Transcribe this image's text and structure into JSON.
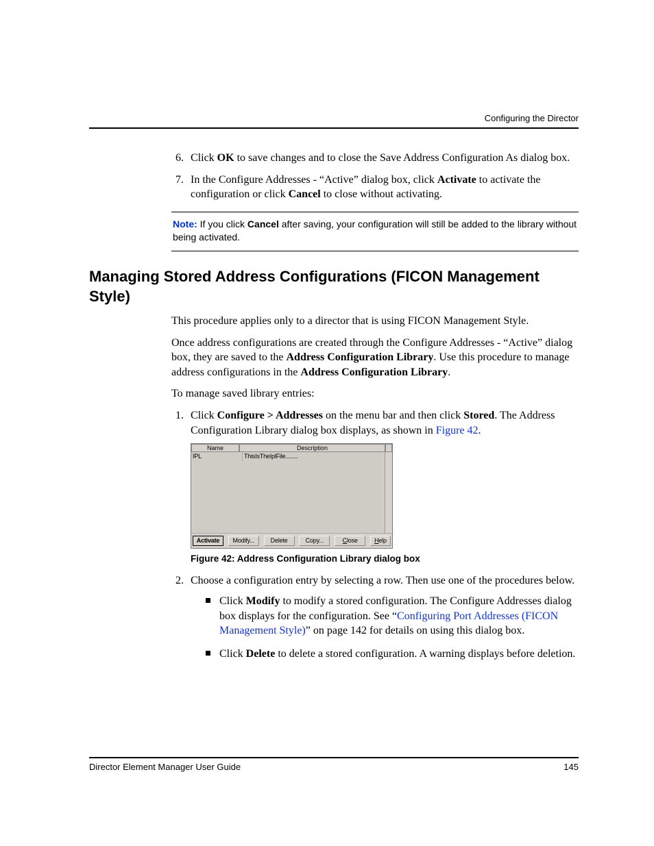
{
  "header": {
    "running_head": "Configuring the Director"
  },
  "steps_continued": {
    "start": 6,
    "items": [
      {
        "pre": "Click ",
        "bold1": "OK",
        "post1": " to save changes and to close the Save Address Configuration As dialog box."
      },
      {
        "pre": "In the Configure Addresses - “Active” dialog box, click ",
        "bold1": "Activate",
        "mid": " to activate the configuration or click ",
        "bold2": "Cancel",
        "post2": " to close without activating."
      }
    ]
  },
  "note": {
    "label": "Note:",
    "pre": "  If you click ",
    "bold": "Cancel",
    "post": " after saving, your configuration will still be added to the library without being activated."
  },
  "section": {
    "heading": "Managing Stored Address Configurations (FICON Management Style)",
    "p1": "This procedure applies only to a director that is using FICON Management Style.",
    "p2_pre": "Once address configurations are created through the Configure Addresses - “Active” dialog box, they are saved to the ",
    "p2_b1": "Address Configuration Library",
    "p2_mid": ". Use this procedure to manage address configurations in the ",
    "p2_b2": "Address Configuration Library",
    "p2_post": ".",
    "p3": "To manage saved library entries:"
  },
  "ordered": {
    "step1_pre": "Click ",
    "step1_b1": "Configure > Addresses",
    "step1_mid": " on the menu bar and then click ",
    "step1_b2": "Stored",
    "step1_post": ". The Address Configuration Library dialog box displays, as shown in ",
    "step1_link": "Figure 42",
    "step1_end": ".",
    "step2": "Choose a configuration entry by selecting a row. Then use one of the procedures below."
  },
  "dialog": {
    "headers": {
      "name": "Name",
      "description": "Description"
    },
    "row": {
      "name": "IPL",
      "description": "ThisIsTheIplFile........"
    },
    "buttons": {
      "activate": "Activate",
      "modify": "Modify...",
      "delete": "Delete",
      "copy": "Copy...",
      "close": "Close",
      "help": "Help"
    }
  },
  "figure_caption": "Figure 42:  Address Configuration Library dialog box",
  "bullets": {
    "b1_pre": "Click ",
    "b1_bold": "Modify",
    "b1_mid": " to modify a stored configuration. The Configure Addresses dialog box displays for the configuration. See “",
    "b1_link": "Configuring Port Addresses (FICON Management Style)",
    "b1_post": "” on page 142 for details on using this dialog box.",
    "b2_pre": "Click ",
    "b2_bold": "Delete",
    "b2_post": " to delete a stored configuration. A warning displays before deletion."
  },
  "footer": {
    "guide": "Director Element Manager User Guide",
    "page": "145"
  }
}
